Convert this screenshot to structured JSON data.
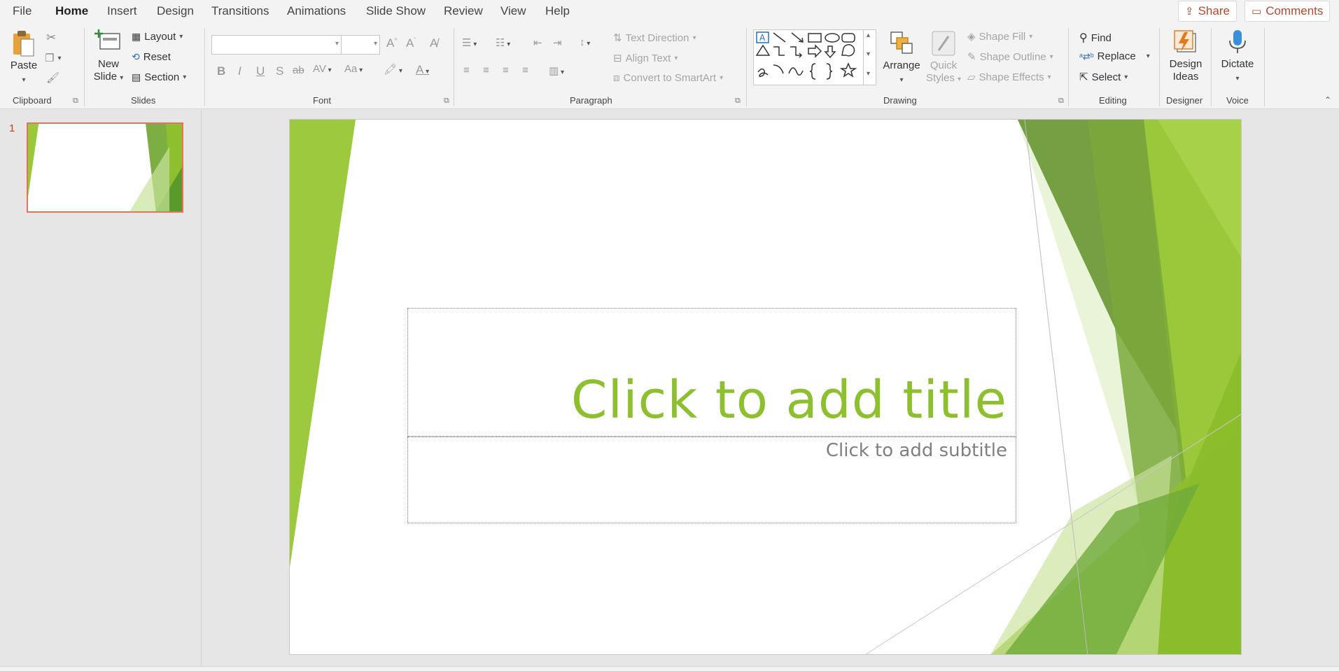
{
  "menu": {
    "tabs": [
      "File",
      "Home",
      "Insert",
      "Design",
      "Transitions",
      "Animations",
      "Slide Show",
      "Review",
      "View",
      "Help"
    ],
    "active_tab": "Home",
    "share_label": "Share",
    "comments_label": "Comments"
  },
  "ribbon": {
    "groups": {
      "clipboard": "Clipboard",
      "slides": "Slides",
      "font": "Font",
      "paragraph": "Paragraph",
      "drawing": "Drawing",
      "editing": "Editing",
      "designer": "Designer",
      "voice": "Voice"
    },
    "clipboard": {
      "paste": "Paste"
    },
    "slides": {
      "new_slide_1": "New",
      "new_slide_2": "Slide",
      "layout": "Layout",
      "reset": "Reset",
      "section": "Section"
    },
    "font": {
      "name_value": "",
      "size_value": "",
      "bold": "B",
      "italic": "I",
      "underline": "U",
      "shadow": "S",
      "strike": "ab",
      "spacing": "AV",
      "case": "Aa"
    },
    "paragraph": {
      "text_direction": "Text Direction",
      "align_text": "Align Text",
      "convert_smartart": "Convert to SmartArt"
    },
    "drawing": {
      "arrange": "Arrange",
      "quick_styles_1": "Quick",
      "quick_styles_2": "Styles",
      "shape_fill": "Shape Fill",
      "shape_outline": "Shape Outline",
      "shape_effects": "Shape Effects"
    },
    "editing": {
      "find": "Find",
      "replace": "Replace",
      "select": "Select"
    },
    "designer": {
      "design_ideas_1": "Design",
      "design_ideas_2": "Ideas"
    },
    "voice": {
      "dictate": "Dictate"
    }
  },
  "thumbnails": {
    "slide_number": "1"
  },
  "slide": {
    "title_placeholder": "Click to add title",
    "subtitle_placeholder": "Click to add subtitle"
  },
  "colors": {
    "accent": "#b7472a",
    "title_green": "#8dbf2e",
    "green_light": "#9bc83b",
    "green_dark": "#5c9a2e"
  }
}
